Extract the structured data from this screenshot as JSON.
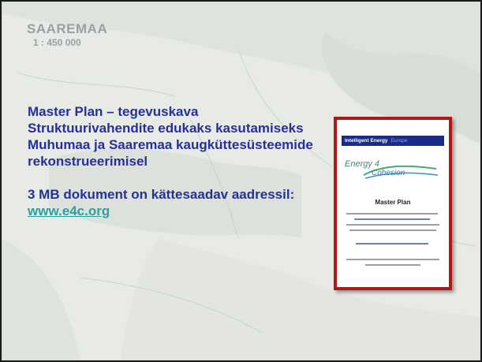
{
  "map": {
    "title": "SAAREMAA",
    "scale": "1 : 450 000"
  },
  "content": {
    "paragraph1": "Master Plan – tegevuskava Struktuurivahendite edukaks kasutamiseks Muhumaa ja Saaremaa kaugküttesüsteemide rekonstrueerimisel",
    "paragraph2_prefix": "3 MB dokument on kättesaadav aadressil: ",
    "link_text": "www.e4c.org"
  },
  "document_cover": {
    "banner": "Intelligent Energy",
    "banner_suffix": "Europe",
    "logo_line1": "Energy 4",
    "logo_line2": "Cohesion",
    "title": "Master Plan"
  },
  "colors": {
    "text": "#26309a",
    "link": "#2aa0a0",
    "cover_border": "#b01818",
    "banner": "#1a2c86"
  }
}
